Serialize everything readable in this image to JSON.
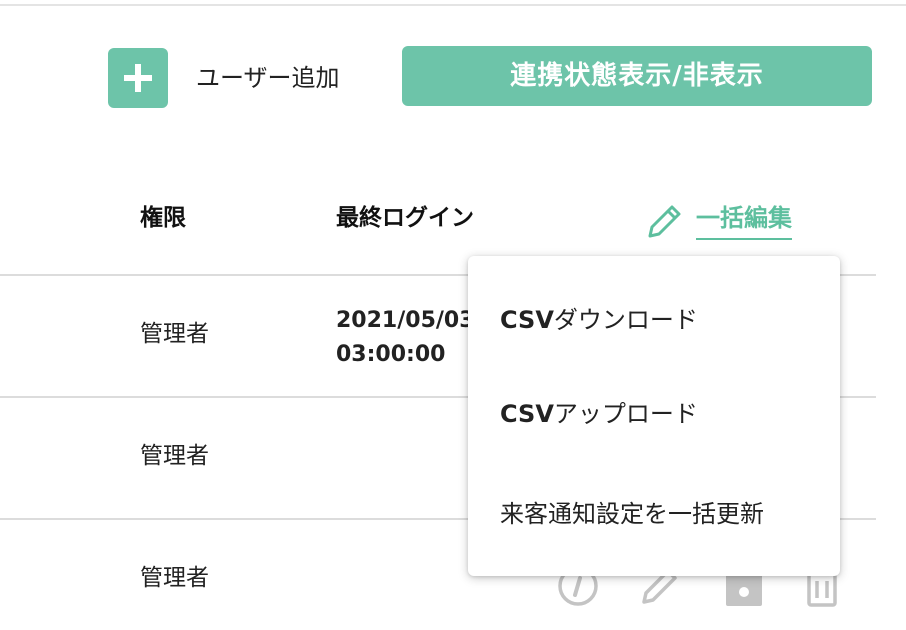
{
  "toolbar": {
    "add_user_label": "ユーザー追加",
    "toggle_link_status_label": "連携状態表示/非表示"
  },
  "table": {
    "headers": {
      "role": "権限",
      "last_login": "最終ログイン",
      "bulk_edit": "一括編集"
    },
    "rows": [
      {
        "role": "管理者",
        "last_login_date": "2021/05/03",
        "last_login_time": "03:00:00"
      },
      {
        "role": "管理者",
        "last_login_date": "",
        "last_login_time": ""
      },
      {
        "role": "管理者",
        "last_login_date": "",
        "last_login_time": ""
      }
    ]
  },
  "bulk_menu": {
    "items": [
      {
        "prefix": "CSV",
        "label": "ダウンロード"
      },
      {
        "prefix": "CSV",
        "label": "アップロード"
      },
      {
        "prefix": "",
        "label": "来客通知設定を一括更新"
      }
    ]
  },
  "icons": {
    "add": "plus-icon",
    "bulk_edit": "pencil-icon",
    "row_info": "info-icon",
    "row_edit": "pencil-icon",
    "row_camera": "camera-icon",
    "row_delete": "trash-icon"
  },
  "colors": {
    "accent": "#6dc4a9",
    "accent_text": "#5dbf9e",
    "divider": "#dcdcdc",
    "icon_gray": "#c4c4c4"
  }
}
